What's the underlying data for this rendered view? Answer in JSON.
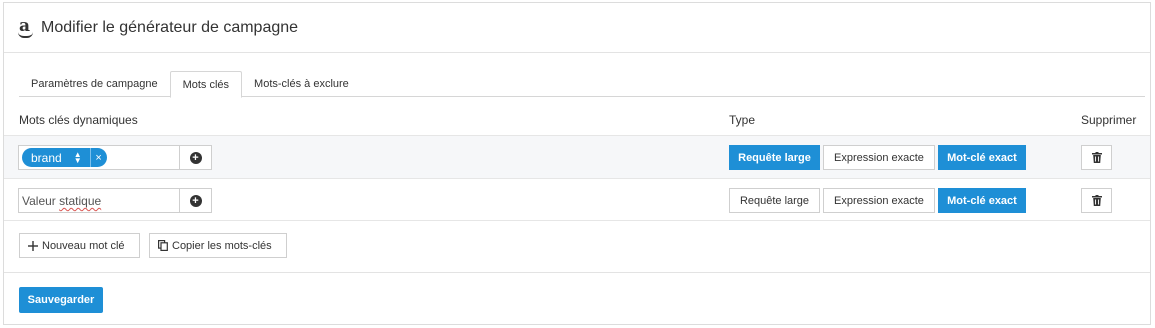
{
  "header": {
    "title": "Modifier le générateur de campagne",
    "logo_letter": "a"
  },
  "tabs": [
    {
      "label": "Paramètres de campagne",
      "active": false
    },
    {
      "label": "Mots clés",
      "active": true
    },
    {
      "label": "Mots-clés à exclure",
      "active": false
    }
  ],
  "columns": {
    "keywords": "Mots clés dynamiques",
    "type": "Type",
    "delete": "Supprimer"
  },
  "rows": [
    {
      "chip": {
        "label": "brand",
        "remove": "×"
      },
      "types": [
        "Requête large",
        "Expression exacte",
        "Mot-clé exact"
      ],
      "selected_type": "Mot-clé exact",
      "broad_selected": true
    },
    {
      "placeholder": "Valeur statique",
      "types": [
        "Requête large",
        "Expression exacte",
        "Mot-clé exact"
      ],
      "selected_type": "Mot-clé exact"
    }
  ],
  "actions": {
    "new_keyword": "Nouveau mot clé",
    "copy_keywords": "Copier les mots-clés"
  },
  "footer": {
    "save": "Sauvegarder"
  },
  "colors": {
    "accent": "#1e8fd6",
    "border": "#cfcfcf",
    "row_highlight": "#f6f7f9"
  },
  "icons": {
    "add": "plus-circle-icon",
    "delete": "trash-icon",
    "new": "plus-icon",
    "copy": "copy-icon",
    "sort": "sort-arrows-icon",
    "remove": "close-icon"
  }
}
